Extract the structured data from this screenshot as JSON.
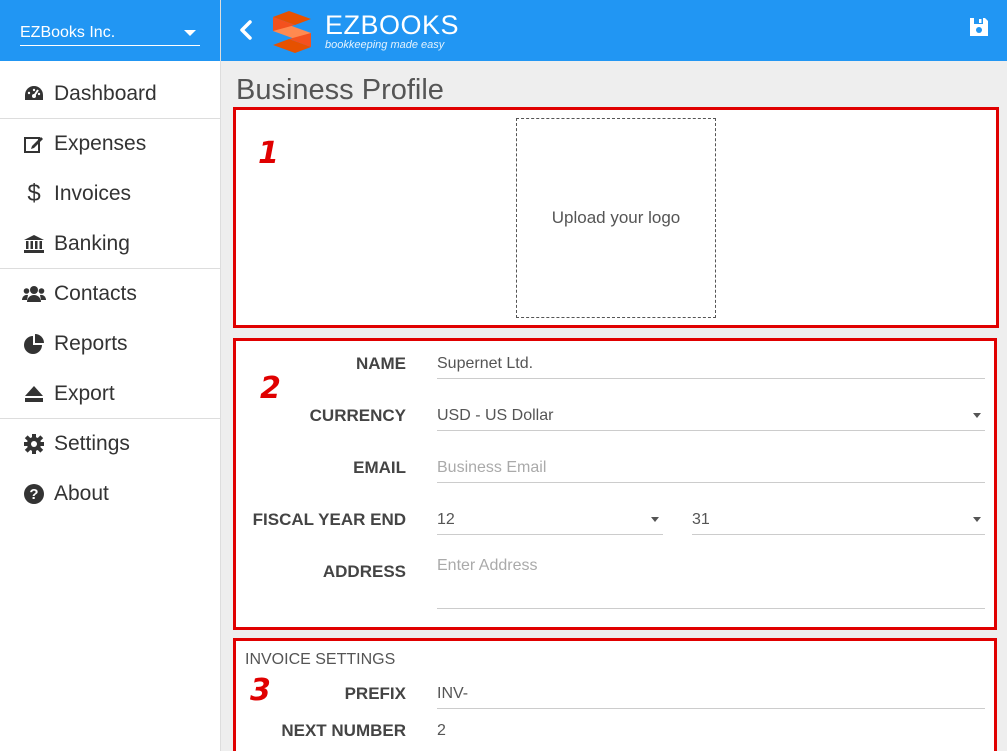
{
  "company": {
    "name": "EZBooks Inc."
  },
  "sidebar": {
    "items": [
      {
        "label": "Dashboard",
        "icon": "dashboard-icon"
      },
      {
        "label": "Expenses",
        "icon": "edit-icon"
      },
      {
        "label": "Invoices",
        "icon": "dollar-icon"
      },
      {
        "label": "Banking",
        "icon": "bank-icon"
      },
      {
        "label": "Contacts",
        "icon": "users-icon"
      },
      {
        "label": "Reports",
        "icon": "pie-chart-icon"
      },
      {
        "label": "Export",
        "icon": "eject-icon"
      },
      {
        "label": "Settings",
        "icon": "gear-icon"
      },
      {
        "label": "About",
        "icon": "question-circle-icon"
      }
    ]
  },
  "header": {
    "brand": "EZBOOKS",
    "tagline": "bookkeeping made easy",
    "accent": "#2196f3"
  },
  "page": {
    "title": "Business Profile"
  },
  "markers": [
    "1",
    "2",
    "3"
  ],
  "logo_upload": {
    "label": "Upload your logo"
  },
  "profile": {
    "name_label": "NAME",
    "name_value": "Supernet Ltd.",
    "currency_label": "CURRENCY",
    "currency_value": "USD - US Dollar",
    "email_label": "EMAIL",
    "email_placeholder": "Business Email",
    "fiscal_label": "FISCAL YEAR END",
    "fiscal_month": "12",
    "fiscal_day": "31",
    "address_label": "ADDRESS",
    "address_placeholder": "Enter Address"
  },
  "invoice_settings": {
    "title": "INVOICE SETTINGS",
    "prefix_label": "PREFIX",
    "prefix_value": "INV-",
    "next_label": "NEXT NUMBER",
    "next_value": "2"
  },
  "colors": {
    "highlight": "#e00000"
  }
}
